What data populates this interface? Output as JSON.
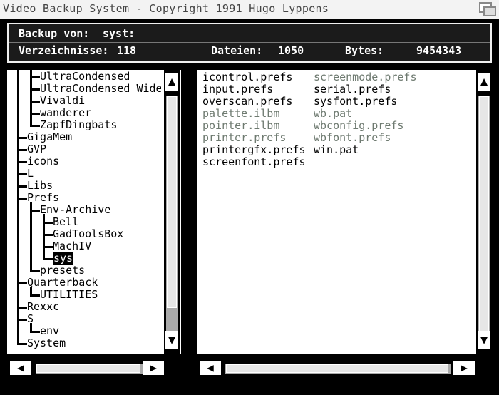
{
  "window": {
    "title": "Video Backup System - Copyright 1991 Hugo Lyppens"
  },
  "info": {
    "backup_label": "Backup von:",
    "backup_value": "syst:",
    "dirs_label": "Verzeichnisse:",
    "dirs_value": "118",
    "files_label": "Dateien:",
    "files_value": "1050",
    "bytes_label": "Bytes:",
    "bytes_value": "9454343"
  },
  "tree": {
    "items": [
      {
        "label": "UltraCondensed",
        "depth": 1
      },
      {
        "label": "UltraCondensed Wide",
        "depth": 1
      },
      {
        "label": "Vivaldi",
        "depth": 1
      },
      {
        "label": "wanderer",
        "depth": 1
      },
      {
        "label": "ZapfDingbats",
        "depth": 1
      },
      {
        "label": "GigaMem",
        "depth": 0
      },
      {
        "label": "GVP",
        "depth": 0
      },
      {
        "label": "icons",
        "depth": 0
      },
      {
        "label": "L",
        "depth": 0
      },
      {
        "label": "Libs",
        "depth": 0
      },
      {
        "label": "Prefs",
        "depth": 0
      },
      {
        "label": "Env-Archive",
        "depth": 1
      },
      {
        "label": "Bell",
        "depth": 2
      },
      {
        "label": "GadToolsBox",
        "depth": 2
      },
      {
        "label": "MachIV",
        "depth": 2
      },
      {
        "label": "sys",
        "depth": 2,
        "selected": true
      },
      {
        "label": "presets",
        "depth": 1
      },
      {
        "label": "Quarterback",
        "depth": 0
      },
      {
        "label": "UTILITIES",
        "depth": 1
      },
      {
        "label": "Rexxc",
        "depth": 0
      },
      {
        "label": "S",
        "depth": 0
      },
      {
        "label": "env",
        "depth": 1
      },
      {
        "label": "System",
        "depth": 0
      }
    ]
  },
  "files": {
    "column1": [
      {
        "name": "icontrol.prefs",
        "dim": false
      },
      {
        "name": "input.prefs",
        "dim": false
      },
      {
        "name": "overscan.prefs",
        "dim": false
      },
      {
        "name": "palette.ilbm",
        "dim": true
      },
      {
        "name": "pointer.ilbm",
        "dim": true
      },
      {
        "name": "printer.prefs",
        "dim": true
      },
      {
        "name": "printergfx.prefs",
        "dim": false
      },
      {
        "name": "screenfont.prefs",
        "dim": false
      }
    ],
    "column2": [
      {
        "name": "screenmode.prefs",
        "dim": true
      },
      {
        "name": "serial.prefs",
        "dim": false
      },
      {
        "name": "sysfont.prefs",
        "dim": false
      },
      {
        "name": "wb.pat",
        "dim": true
      },
      {
        "name": "wbconfig.prefs",
        "dim": true
      },
      {
        "name": "wbfont.prefs",
        "dim": true
      },
      {
        "name": "win.pat",
        "dim": false
      }
    ]
  },
  "scroll": {
    "left_vertical_fraction": 0.88,
    "right_vertical_fraction": 1.0
  },
  "icons": {
    "up": "▲",
    "down": "▼",
    "left": "◀",
    "right": "▶"
  }
}
